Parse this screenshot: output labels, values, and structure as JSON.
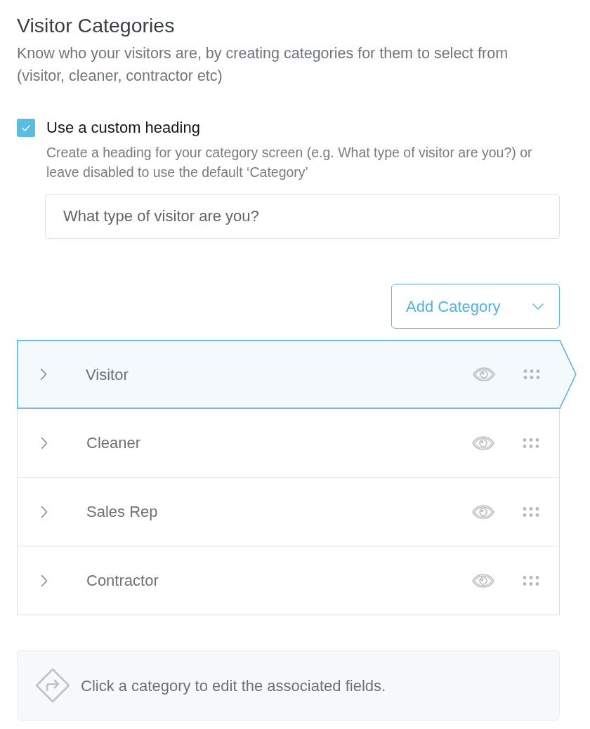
{
  "title": "Visitor Categories",
  "description": "Know who your visitors are, by creating categories for them to select from (visitor, cleaner, contractor etc)",
  "custom_heading": {
    "label": "Use a custom heading",
    "checked": true,
    "help": "Create a heading for your category screen (e.g. What type of visitor are you?) or leave disabled to use the default ‘Category’",
    "value": "What type of visitor are you?"
  },
  "add_button": {
    "label": "Add Category"
  },
  "categories": [
    {
      "name": "Visitor",
      "selected": true
    },
    {
      "name": "Cleaner",
      "selected": false
    },
    {
      "name": "Sales Rep",
      "selected": false
    },
    {
      "name": "Contractor",
      "selected": false
    }
  ],
  "info": {
    "text": "Click a category to edit the associated fields."
  }
}
